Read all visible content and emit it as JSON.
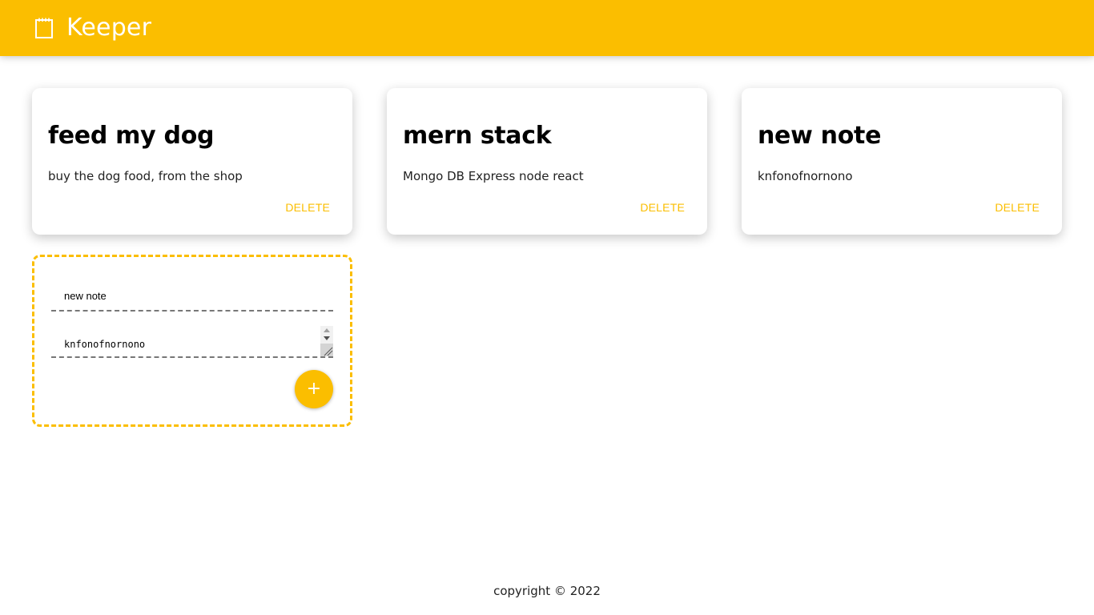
{
  "header": {
    "title": "Keeper",
    "icon": "notepad-icon",
    "background_color": "#fbbe00"
  },
  "notes": [
    {
      "title": "feed my dog",
      "content": "buy the dog food, from the shop",
      "delete_label": "DELETE"
    },
    {
      "title": "mern stack",
      "content": "Mongo DB Express node react",
      "delete_label": "DELETE"
    },
    {
      "title": "new note",
      "content": "knfonofnornono",
      "delete_label": "DELETE"
    }
  ],
  "create_area": {
    "title_value": "new note",
    "content_value": "knfonofnornono",
    "add_label": "+",
    "border_color": "#fbbe00"
  },
  "footer": {
    "text": "copyright © 2022"
  },
  "accent_color": "#fbbe00"
}
